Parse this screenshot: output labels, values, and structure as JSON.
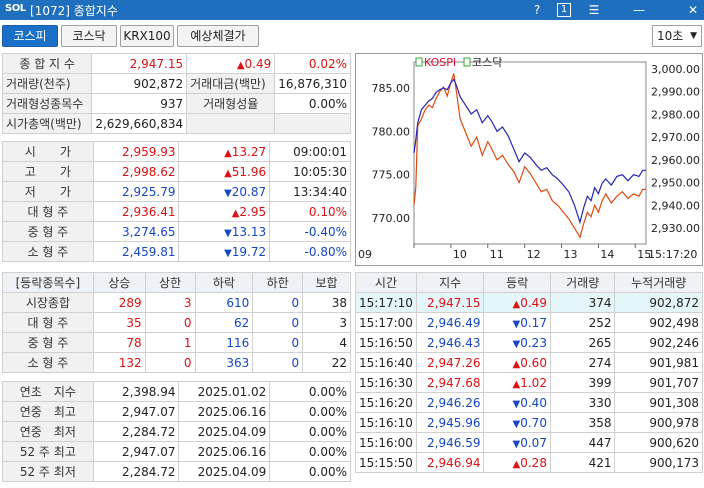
{
  "window": {
    "logo": "SOL",
    "title": "[1072] 종합지수",
    "help": "?",
    "one": "1",
    "menu": "☰",
    "minimize": "—",
    "close": "✕"
  },
  "tabs": [
    {
      "label": "코스피",
      "active": true
    },
    {
      "label": "코스닥"
    },
    {
      "label": "KRX100"
    },
    {
      "label": "예상체결가"
    }
  ],
  "interval": {
    "value": "10초"
  },
  "summary": {
    "idx_label": "종 합 지 수",
    "idx_value": "2,947.15",
    "idx_change": "0.49",
    "idx_rate": "0.02%",
    "vol_label": "거래량(천주)",
    "vol_value": "902,872",
    "amt_label": "거래대금(백만)",
    "amt_value": "16,876,310",
    "cnt_label": "거래형성종목수",
    "cnt_value": "937",
    "ratio_label": "거래형성율",
    "ratio_value": "0.00%",
    "cap_label": "시가총액(백만)",
    "cap_value": "2,629,660,834"
  },
  "prices": [
    {
      "label": "시　　가",
      "value": "2,959.93",
      "dir": "up",
      "change": "13.27",
      "extra": "09:00:01"
    },
    {
      "label": "고　　가",
      "value": "2,998.62",
      "dir": "up",
      "change": "51.96",
      "extra": "10:05:30"
    },
    {
      "label": "저　　가",
      "value": "2,925.79",
      "dir": "dn",
      "change": "20.87",
      "extra": "13:34:40"
    },
    {
      "label": "대 형 주",
      "value": "2,936.41",
      "dir": "up",
      "change": "2.95",
      "extra": "0.10%"
    },
    {
      "label": "중 형 주",
      "value": "3,274.65",
      "dir": "dn",
      "change": "13.13",
      "extra": "-0.40%"
    },
    {
      "label": "소 형 주",
      "value": "2,459.81",
      "dir": "dn",
      "change": "19.72",
      "extra": "-0.80%"
    }
  ],
  "breadth": {
    "headers": [
      "[등락종목수]",
      "상승",
      "상한",
      "하락",
      "하한",
      "보합"
    ],
    "rows": [
      {
        "label": "시장종합",
        "up": "289",
        "uplim": "3",
        "dn": "610",
        "dnlim": "0",
        "flat": "38"
      },
      {
        "label": "대 형 주",
        "up": "35",
        "uplim": "0",
        "dn": "62",
        "dnlim": "0",
        "flat": "3"
      },
      {
        "label": "중 형 주",
        "up": "78",
        "uplim": "1",
        "dn": "116",
        "dnlim": "0",
        "flat": "4"
      },
      {
        "label": "소 형 주",
        "up": "132",
        "uplim": "0",
        "dn": "363",
        "dnlim": "0",
        "flat": "22"
      }
    ]
  },
  "yearly": [
    {
      "label": "연초　지수",
      "value": "2,398.94",
      "date": "2025.01.02",
      "rate": "0.00%"
    },
    {
      "label": "연중　최고",
      "value": "2,947.07",
      "date": "2025.06.16",
      "rate": "0.00%"
    },
    {
      "label": "연중　최저",
      "value": "2,284.72",
      "date": "2025.04.09",
      "rate": "0.00%"
    },
    {
      "label": "52 주 최고",
      "value": "2,947.07",
      "date": "2025.06.16",
      "rate": "0.00%"
    },
    {
      "label": "52 주 최저",
      "value": "2,284.72",
      "date": "2025.04.09",
      "rate": "0.00%"
    }
  ],
  "ticks": {
    "headers": [
      "시간",
      "지수",
      "등락",
      "거래량",
      "누적거래량"
    ],
    "rows": [
      {
        "time": "15:17:10",
        "value": "2,947.15",
        "color": "red",
        "dir": "up",
        "change": "0.49",
        "vol": "374",
        "cum": "902,872"
      },
      {
        "time": "15:17:00",
        "value": "2,946.49",
        "color": "blue",
        "dir": "dn",
        "change": "0.17",
        "vol": "252",
        "cum": "902,498"
      },
      {
        "time": "15:16:50",
        "value": "2,946.43",
        "color": "blue",
        "dir": "dn",
        "change": "0.23",
        "vol": "265",
        "cum": "902,246"
      },
      {
        "time": "15:16:40",
        "value": "2,947.26",
        "color": "red",
        "dir": "up",
        "change": "0.60",
        "vol": "274",
        "cum": "901,981"
      },
      {
        "time": "15:16:30",
        "value": "2,947.68",
        "color": "red",
        "dir": "up",
        "change": "1.02",
        "vol": "399",
        "cum": "901,707"
      },
      {
        "time": "15:16:20",
        "value": "2,946.26",
        "color": "blue",
        "dir": "dn",
        "change": "0.40",
        "vol": "330",
        "cum": "901,308"
      },
      {
        "time": "15:16:10",
        "value": "2,945.96",
        "color": "blue",
        "dir": "dn",
        "change": "0.70",
        "vol": "358",
        "cum": "900,978"
      },
      {
        "time": "15:16:00",
        "value": "2,946.59",
        "color": "blue",
        "dir": "dn",
        "change": "0.07",
        "vol": "447",
        "cum": "900,620"
      },
      {
        "time": "15:15:50",
        "value": "2,946.94",
        "color": "red",
        "dir": "up",
        "change": "0.28",
        "vol": "421",
        "cum": "900,173"
      }
    ]
  },
  "chart_data": {
    "type": "line",
    "legend": [
      "KOSPI",
      "코스닥"
    ],
    "x_ticks": [
      "09",
      "10",
      "11",
      "12",
      "13",
      "14",
      "15",
      "15:17:20"
    ],
    "y_left_ticks": [
      "785.00",
      "780.00",
      "775.00",
      "770.00"
    ],
    "y_left_range": [
      767,
      788
    ],
    "y_right_ticks": [
      "3,000.00",
      "2,990.00",
      "2,980.00",
      "2,970.00",
      "2,960.00",
      "2,950.00",
      "2,940.00",
      "2,930.00"
    ],
    "y_right_range": [
      2923,
      3003
    ],
    "time_range": [
      9.0,
      15.29
    ],
    "series": [
      {
        "name": "KOSPI",
        "color": "#e04a10",
        "axis": "right",
        "points": [
          [
            9.0,
            2940
          ],
          [
            9.05,
            2948
          ],
          [
            9.1,
            2975
          ],
          [
            9.2,
            2978
          ],
          [
            9.3,
            2982
          ],
          [
            9.4,
            2984
          ],
          [
            9.5,
            2983
          ],
          [
            9.6,
            2987
          ],
          [
            9.7,
            2990
          ],
          [
            9.8,
            2992
          ],
          [
            9.9,
            2988
          ],
          [
            10.0,
            2994
          ],
          [
            10.08,
            2998
          ],
          [
            10.15,
            2990
          ],
          [
            10.25,
            2978
          ],
          [
            10.4,
            2972
          ],
          [
            10.55,
            2966
          ],
          [
            10.7,
            2970
          ],
          [
            10.85,
            2962
          ],
          [
            11.0,
            2968
          ],
          [
            11.1,
            2965
          ],
          [
            11.25,
            2960
          ],
          [
            11.4,
            2962
          ],
          [
            11.55,
            2958
          ],
          [
            11.7,
            2955
          ],
          [
            11.85,
            2950
          ],
          [
            12.0,
            2957
          ],
          [
            12.15,
            2954
          ],
          [
            12.3,
            2950
          ],
          [
            12.45,
            2946
          ],
          [
            12.6,
            2947
          ],
          [
            12.75,
            2942
          ],
          [
            12.9,
            2940
          ],
          [
            13.05,
            2937
          ],
          [
            13.2,
            2934
          ],
          [
            13.35,
            2930
          ],
          [
            13.5,
            2926
          ],
          [
            13.6,
            2932
          ],
          [
            13.7,
            2937
          ],
          [
            13.8,
            2935
          ],
          [
            13.9,
            2940
          ],
          [
            14.0,
            2937
          ],
          [
            14.1,
            2942
          ],
          [
            14.2,
            2945
          ],
          [
            14.35,
            2941
          ],
          [
            14.5,
            2944
          ],
          [
            14.65,
            2946
          ],
          [
            14.8,
            2943
          ],
          [
            14.95,
            2945
          ],
          [
            15.1,
            2944
          ],
          [
            15.2,
            2947
          ],
          [
            15.29,
            2947
          ]
        ]
      },
      {
        "name": "코스닥",
        "color": "#2525b0",
        "axis": "left",
        "points": [
          [
            9.0,
            777.5
          ],
          [
            9.05,
            779
          ],
          [
            9.1,
            781
          ],
          [
            9.2,
            782.5
          ],
          [
            9.3,
            783
          ],
          [
            9.4,
            783.5
          ],
          [
            9.5,
            783.8
          ],
          [
            9.6,
            784.5
          ],
          [
            9.7,
            784.8
          ],
          [
            9.8,
            785
          ],
          [
            9.9,
            784.8
          ],
          [
            10.0,
            785.6
          ],
          [
            10.08,
            786
          ],
          [
            10.15,
            785.3
          ],
          [
            10.25,
            784
          ],
          [
            10.4,
            783
          ],
          [
            10.55,
            782
          ],
          [
            10.7,
            782.5
          ],
          [
            10.85,
            781
          ],
          [
            11.0,
            781.8
          ],
          [
            11.1,
            781.2
          ],
          [
            11.25,
            780
          ],
          [
            11.4,
            780.5
          ],
          [
            11.55,
            779.5
          ],
          [
            11.7,
            778
          ],
          [
            11.85,
            776.5
          ],
          [
            12.0,
            777.5
          ],
          [
            12.15,
            777
          ],
          [
            12.3,
            776.2
          ],
          [
            12.45,
            775.5
          ],
          [
            12.6,
            775.8
          ],
          [
            12.75,
            775
          ],
          [
            12.9,
            774.5
          ],
          [
            13.05,
            773.8
          ],
          [
            13.2,
            773
          ],
          [
            13.35,
            771.5
          ],
          [
            13.5,
            769.5
          ],
          [
            13.6,
            771.2
          ],
          [
            13.7,
            772.5
          ],
          [
            13.8,
            772
          ],
          [
            13.9,
            773.5
          ],
          [
            14.0,
            772.8
          ],
          [
            14.1,
            774
          ],
          [
            14.2,
            774.5
          ],
          [
            14.35,
            773.8
          ],
          [
            14.5,
            774.8
          ],
          [
            14.65,
            775
          ],
          [
            14.8,
            774.3
          ],
          [
            14.95,
            775
          ],
          [
            15.1,
            774.8
          ],
          [
            15.2,
            775.5
          ],
          [
            15.29,
            775.5
          ]
        ]
      }
    ]
  }
}
